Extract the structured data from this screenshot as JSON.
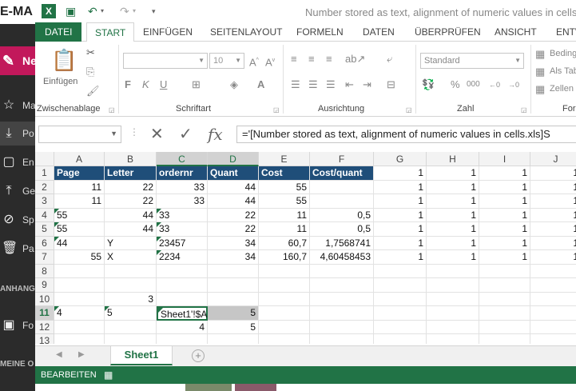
{
  "bg_app": {
    "title_fragment": "E-MA",
    "new_label": "Ne",
    "items": [
      {
        "icon": "star-icon",
        "label": "Ma"
      },
      {
        "icon": "download-icon",
        "label": "Po"
      },
      {
        "icon": "document-icon",
        "label": "En"
      },
      {
        "icon": "upload-icon",
        "label": "Ge"
      },
      {
        "icon": "cancel-icon",
        "label": "Sp"
      },
      {
        "icon": "trash-icon",
        "label": "Pa"
      },
      {
        "icon": "image-icon",
        "label": "Fo"
      }
    ],
    "section1": "ANHANG",
    "section2": "MEINE O"
  },
  "title": "Number stored as text, alignment of numeric values in cells.xls]",
  "ribbon_tabs": [
    "DATEI",
    "START",
    "EINFÜGEN",
    "SEITENLAYOUT",
    "FORMELN",
    "DATEN",
    "ÜBERPRÜFEN",
    "ANSICHT",
    "ENTW"
  ],
  "ribbon": {
    "paste_label": "Einfügen",
    "clipboard_label": "Zwischenablage",
    "font_label": "Schriftart",
    "font_size": "10",
    "bold": "F",
    "italic": "K",
    "underline": "U",
    "alignment_label": "Ausrichtung",
    "number_label": "Zahl",
    "number_format": "Standard",
    "percent": "%",
    "thousands": "000",
    "cond_format": "Beding",
    "as_table": "Als Tab",
    "cell_styles": "Zellen",
    "styles_fragment": "For"
  },
  "formula_bar": {
    "name_box": "",
    "formula": "='[Number stored as text, alignment of numeric values in cells.xls]S"
  },
  "columns": [
    "A",
    "B",
    "C",
    "D",
    "E",
    "F",
    "G",
    "H",
    "I",
    "J"
  ],
  "rows": [
    "1",
    "2",
    "3",
    "4",
    "5",
    "6",
    "7",
    "8",
    "9",
    "10",
    "11",
    "12",
    "13"
  ],
  "cells": {
    "r1": [
      "Page",
      "Letter",
      "ordernr",
      "Quant",
      "Cost",
      "Cost/quant",
      "1",
      "1",
      "1",
      "1"
    ],
    "r2": [
      "11",
      "22",
      "33",
      "44",
      "55",
      "",
      "1",
      "1",
      "1",
      "1"
    ],
    "r3": [
      "11",
      "22",
      "33",
      "44",
      "55",
      "",
      "1",
      "1",
      "1",
      "1"
    ],
    "r4": [
      "55",
      "44",
      "33",
      "22",
      "11",
      "0,5",
      "1",
      "1",
      "1",
      "1"
    ],
    "r5": [
      "55",
      "44",
      "33",
      "22",
      "11",
      "0,5",
      "1",
      "1",
      "1",
      "1"
    ],
    "r6": [
      "44",
      "Y",
      "23457",
      "34",
      "60,7",
      "1,7568741",
      "1",
      "1",
      "1",
      "1"
    ],
    "r7": [
      "55",
      "X",
      "2234",
      "34",
      "160,7",
      "4,60458453",
      "1",
      "1",
      "1",
      "1"
    ],
    "r10": [
      "",
      "3"
    ],
    "r11": [
      "4",
      "5",
      "Sheet1'!$A",
      "5"
    ],
    "r12": [
      "",
      "",
      "4",
      "5"
    ]
  },
  "sheet_tab": "Sheet1",
  "status": "BEARBEITEN",
  "colors": {
    "excel_green": "#217346",
    "header_fill": "#1f4e79"
  }
}
